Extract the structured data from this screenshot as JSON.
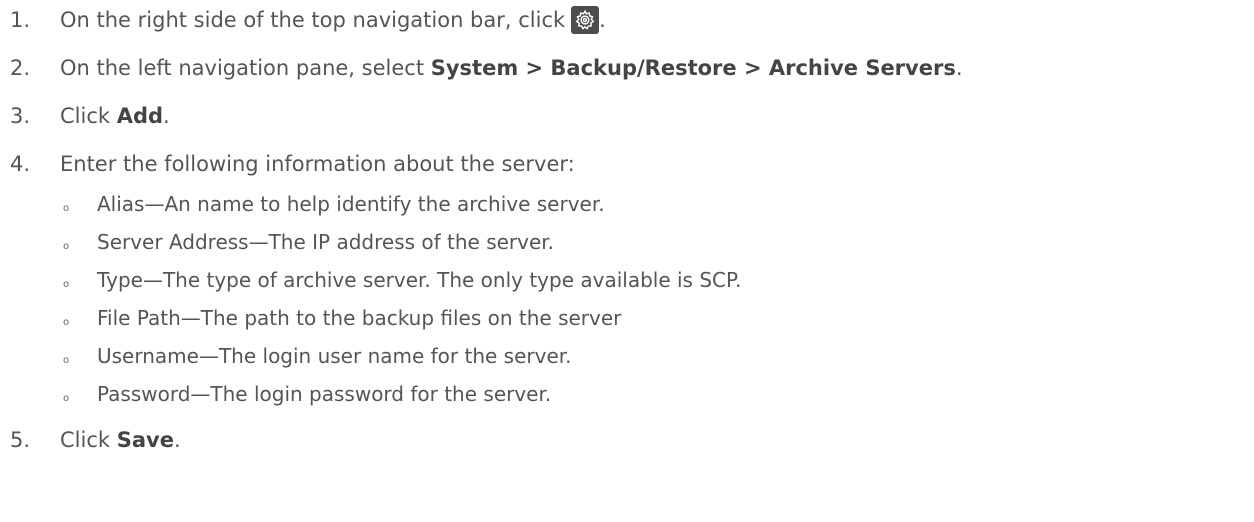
{
  "steps": [
    {
      "number": "1.",
      "text": "On the right side of the top navigation bar, click",
      "suffix": ".",
      "icon": "gear-icon"
    },
    {
      "number": "2.",
      "text": "On the left navigation pane, select ",
      "bold": "System > Backup/Restore > Archive Servers",
      "suffix": "."
    },
    {
      "number": "3.",
      "text": "Click ",
      "bold": "Add",
      "suffix": "."
    },
    {
      "number": "4.",
      "text": "Enter the following information about the server:"
    },
    {
      "number": "5.",
      "text": "Click ",
      "bold": "Save",
      "suffix": "."
    }
  ],
  "fields": [
    {
      "bullet": "o",
      "text": "Alias—An name to help identify the archive server."
    },
    {
      "bullet": "o",
      "text": "Server Address—The IP address of the server."
    },
    {
      "bullet": "o",
      "text": "Type—The type of archive server. The only type available is SCP."
    },
    {
      "bullet": "o",
      "text": "File Path—The path to the backup files on the server"
    },
    {
      "bullet": "o",
      "text": "Username—The login user name for the server."
    },
    {
      "bullet": "o",
      "text": "Password—The login password for the server."
    }
  ],
  "colors": {
    "text": "#555555",
    "icon_background": "#4d4d4d",
    "icon_foreground": "#ffffff"
  }
}
